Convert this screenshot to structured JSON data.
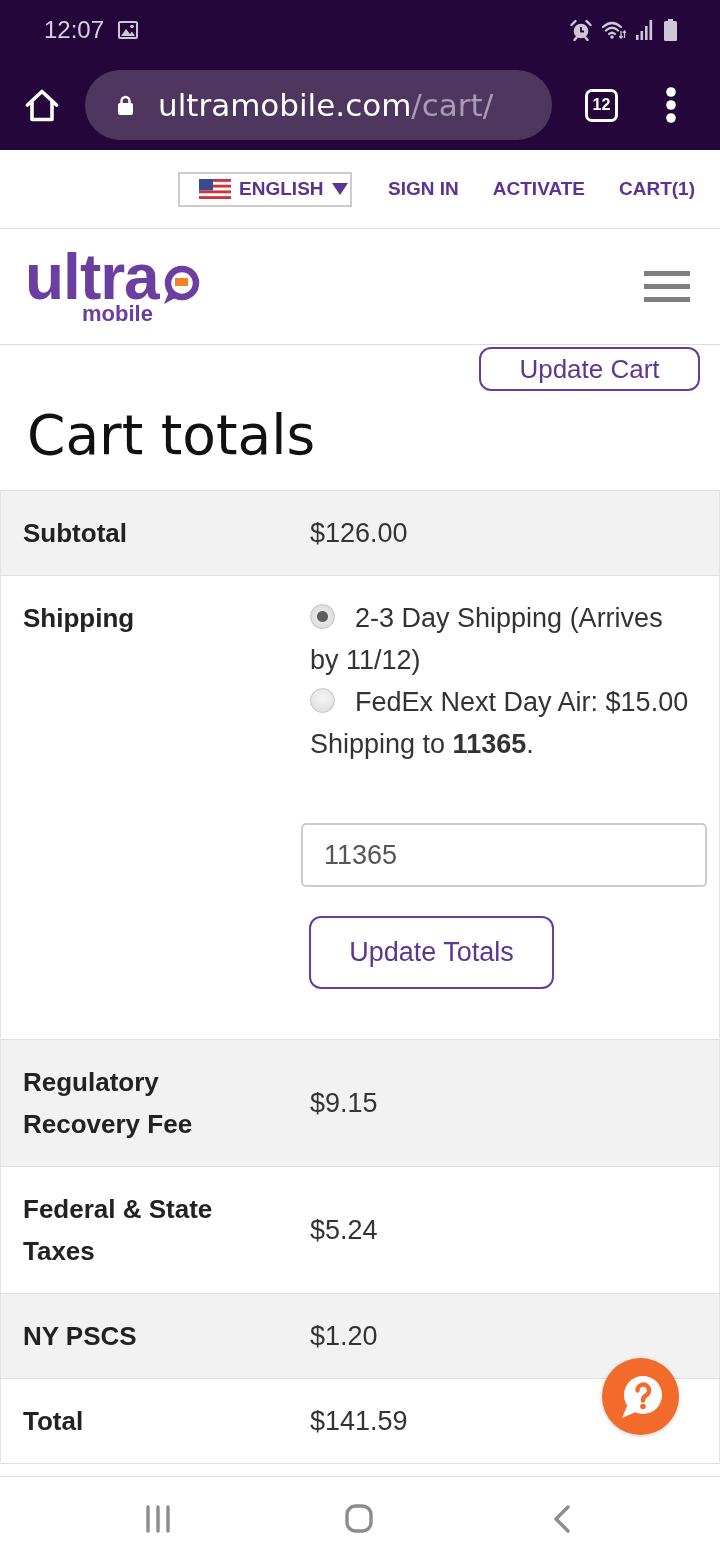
{
  "status_bar": {
    "time": "12:07"
  },
  "browser_toolbar": {
    "url_host": "ultramobile.com",
    "url_path": "/cart/",
    "tab_count": "12"
  },
  "top_nav": {
    "language": "ENGLISH",
    "links": [
      "SIGN IN",
      "ACTIVATE",
      "CART(1)"
    ]
  },
  "logo": {
    "wordmark": "ultra",
    "subtitle": "mobile"
  },
  "update_cart_button": "Update Cart",
  "cart_totals": {
    "title": "Cart totals",
    "rows": [
      {
        "kind": "amount",
        "label": "Subtotal",
        "value": "$126.00"
      },
      {
        "kind": "shipping",
        "label": "Shipping",
        "options": [
          {
            "label": "2-3 Day Shipping (Arrives by 11/12)",
            "selected": true
          },
          {
            "label": "FedEx Next Day Air: $15.00",
            "selected": false
          }
        ],
        "destination": "Shipping to **11365**.",
        "postcode": {
          "value": "11365"
        },
        "button": "Update Totals"
      },
      {
        "kind": "amount",
        "label": "Regulatory Recovery Fee",
        "value": "$9.15"
      },
      {
        "kind": "amount",
        "label": "Federal & State Taxes",
        "value": "$5.24"
      },
      {
        "kind": "amount",
        "label": "NY PSCS",
        "value": "$1.20"
      },
      {
        "kind": "amount",
        "label": "Total",
        "value": "$141.59"
      }
    ]
  }
}
